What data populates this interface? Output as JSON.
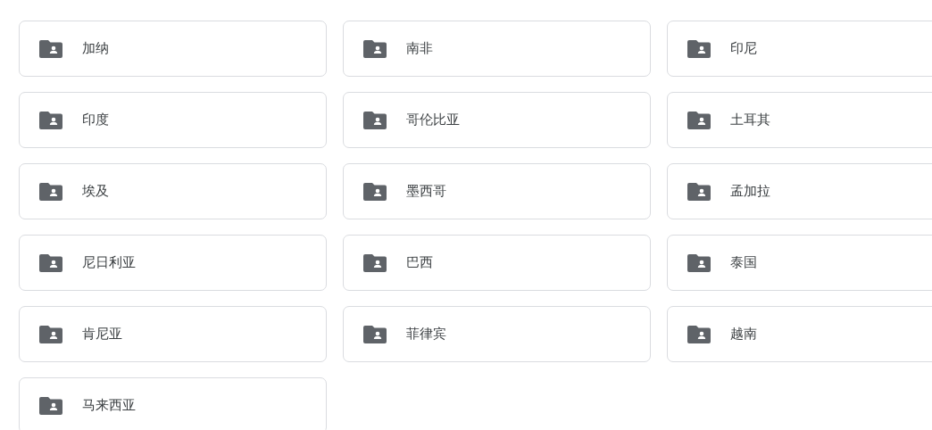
{
  "folders": [
    {
      "name": "加纳"
    },
    {
      "name": "南非"
    },
    {
      "name": "印尼"
    },
    {
      "name": "印度"
    },
    {
      "name": "哥伦比亚"
    },
    {
      "name": "土耳其"
    },
    {
      "name": "埃及"
    },
    {
      "name": "墨西哥"
    },
    {
      "name": "孟加拉"
    },
    {
      "name": "尼日利亚"
    },
    {
      "name": "巴西"
    },
    {
      "name": "泰国"
    },
    {
      "name": "肯尼亚"
    },
    {
      "name": "菲律宾"
    },
    {
      "name": "越南"
    },
    {
      "name": "马来西亚"
    }
  ]
}
